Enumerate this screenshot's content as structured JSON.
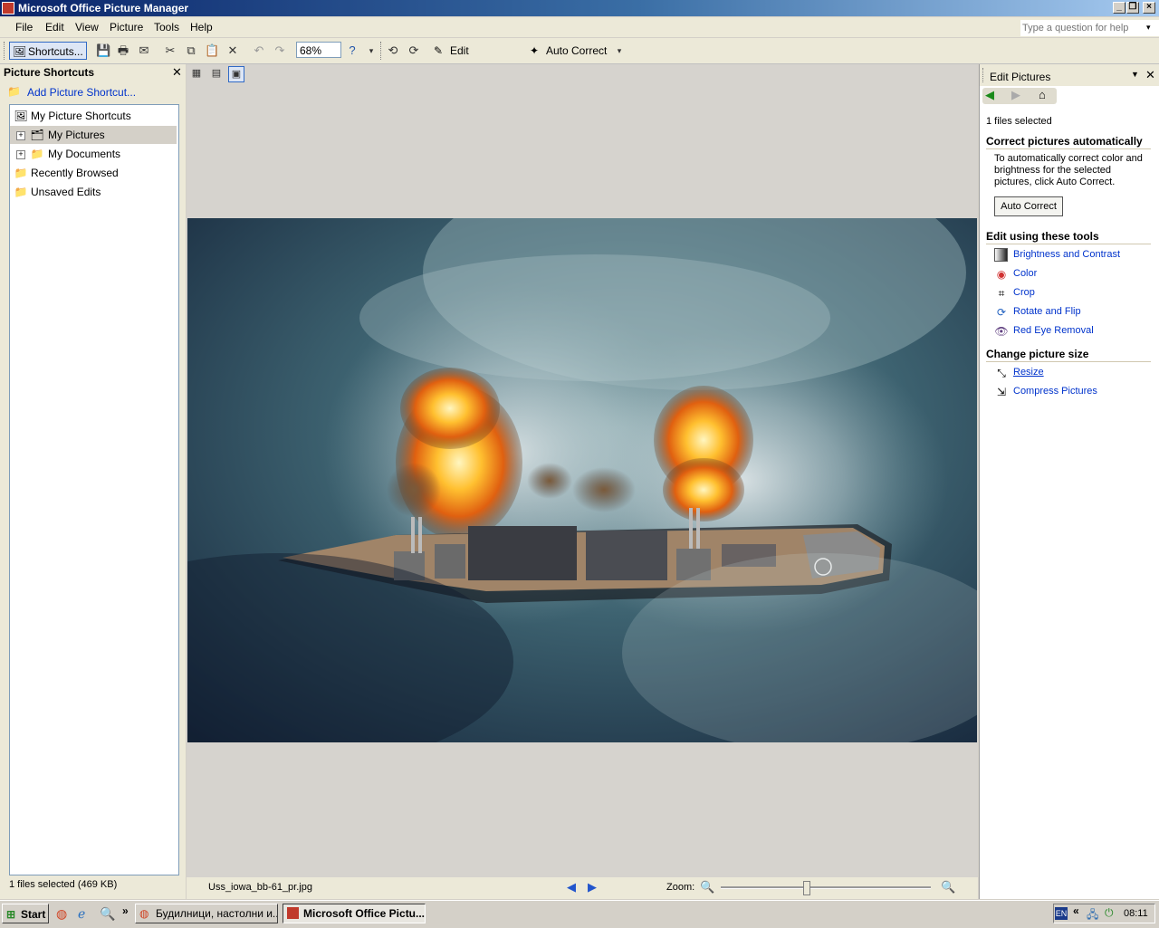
{
  "window": {
    "title": "Microsoft Office Picture Manager"
  },
  "menu": {
    "items": [
      "File",
      "Edit",
      "View",
      "Picture",
      "Tools",
      "Help"
    ],
    "help_placeholder": "Type a question for help"
  },
  "toolbar": {
    "shortcuts_label": "Shortcuts...",
    "zoom_value": "68%",
    "edit_pictures_label": "Edit Pictures...",
    "auto_correct_label": "Auto Correct"
  },
  "left_pane": {
    "title": "Picture Shortcuts",
    "add_shortcut": "Add Picture Shortcut...",
    "tree": [
      "My Picture Shortcuts",
      "My Pictures",
      "My Documents",
      "Recently Browsed",
      "Unsaved Edits"
    ],
    "status": "1 files selected (469 KB)"
  },
  "main": {
    "filename": "Uss_iowa_bb-61_pr.jpg",
    "zoom_label": "Zoom:",
    "zoom_slider_fraction": 0.41
  },
  "right_pane": {
    "title": "Edit Pictures",
    "selection": "1 files selected",
    "section_auto": "Correct pictures automatically",
    "auto_description": "To automatically correct color and brightness for the selected pictures, click Auto Correct.",
    "auto_button": "Auto Correct",
    "section_tools": "Edit using these tools",
    "tools": [
      "Brightness and Contrast",
      "Color",
      "Crop",
      "Rotate and Flip",
      "Red Eye Removal"
    ],
    "section_size": "Change picture size",
    "size_tools": [
      "Resize",
      "Compress Pictures"
    ]
  },
  "taskbar": {
    "start": "Start",
    "tasks": [
      "Будилници, настолни и...",
      "Microsoft Office Pictu..."
    ],
    "lang": "EN",
    "clock": "08:11"
  }
}
